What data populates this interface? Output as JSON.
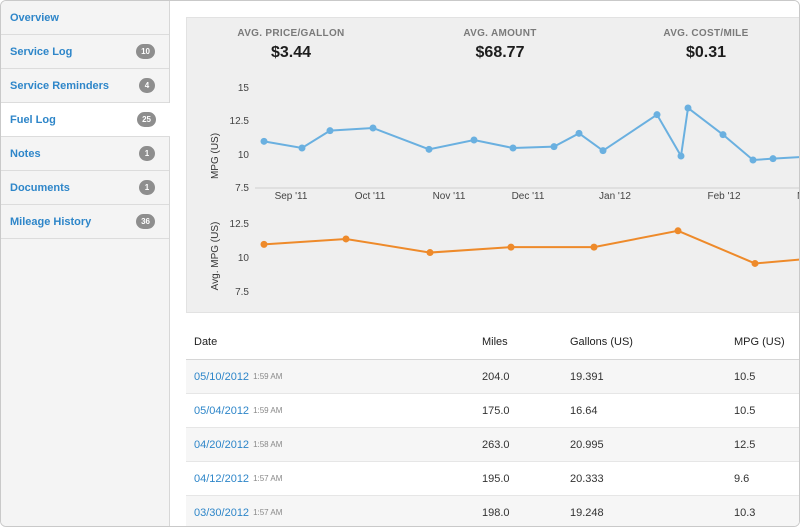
{
  "sidebar": {
    "items": [
      {
        "label": "Overview",
        "badge": ""
      },
      {
        "label": "Service Log",
        "badge": "10"
      },
      {
        "label": "Service Reminders",
        "badge": "4"
      },
      {
        "label": "Fuel Log",
        "badge": "25"
      },
      {
        "label": "Notes",
        "badge": "1"
      },
      {
        "label": "Documents",
        "badge": "1"
      },
      {
        "label": "Mileage History",
        "badge": "36"
      }
    ],
    "active_item": "Fuel Log"
  },
  "stats": [
    {
      "label": "AVG. PRICE/GALLON",
      "value": "$3.44"
    },
    {
      "label": "AVG. AMOUNT",
      "value": "$68.77"
    },
    {
      "label": "AVG. COST/MILE",
      "value": "$0.31"
    }
  ],
  "chart_data": [
    {
      "type": "line",
      "ylabel": "MPG (US)",
      "yticks": [
        "15",
        "12.5",
        "10",
        "7.5"
      ],
      "ylim": [
        7.5,
        15
      ],
      "x_tick_labels": [
        "Sep '11",
        "Oct '11",
        "Nov '11",
        "Dec '11",
        "Jan '12",
        "Feb '12",
        "Ma"
      ],
      "color": "#6ab0e0",
      "series": [
        {
          "values": [
            11.0,
            10.5,
            11.8,
            12.0,
            10.4,
            11.1,
            10.5,
            10.6,
            11.6,
            10.3,
            13.0,
            9.9,
            13.5,
            11.5,
            9.6,
            9.7,
            9.9
          ]
        }
      ]
    },
    {
      "type": "line",
      "ylabel": "Avg. MPG (US)",
      "yticks": [
        "12.5",
        "10",
        "7.5"
      ],
      "ylim": [
        7.5,
        12.5
      ],
      "color": "#ee8a2a",
      "series": [
        {
          "values": [
            11.0,
            11.4,
            10.4,
            10.8,
            10.8,
            12.0,
            9.6,
            10.0
          ]
        }
      ]
    }
  ],
  "table": {
    "headers": {
      "date": "Date",
      "miles": "Miles",
      "gallons": "Gallons (US)",
      "mpg": "MPG (US)"
    },
    "rows": [
      {
        "date": "05/10/2012",
        "time": "1:59 AM",
        "miles": "204.0",
        "gallons": "19.391",
        "mpg": "10.5"
      },
      {
        "date": "05/04/2012",
        "time": "1:59 AM",
        "miles": "175.0",
        "gallons": "16.64",
        "mpg": "10.5"
      },
      {
        "date": "04/20/2012",
        "time": "1:58 AM",
        "miles": "263.0",
        "gallons": "20.995",
        "mpg": "12.5"
      },
      {
        "date": "04/12/2012",
        "time": "1:57 AM",
        "miles": "195.0",
        "gallons": "20.333",
        "mpg": "9.6"
      },
      {
        "date": "03/30/2012",
        "time": "1:57 AM",
        "miles": "198.0",
        "gallons": "19.248",
        "mpg": "10.3"
      }
    ]
  }
}
